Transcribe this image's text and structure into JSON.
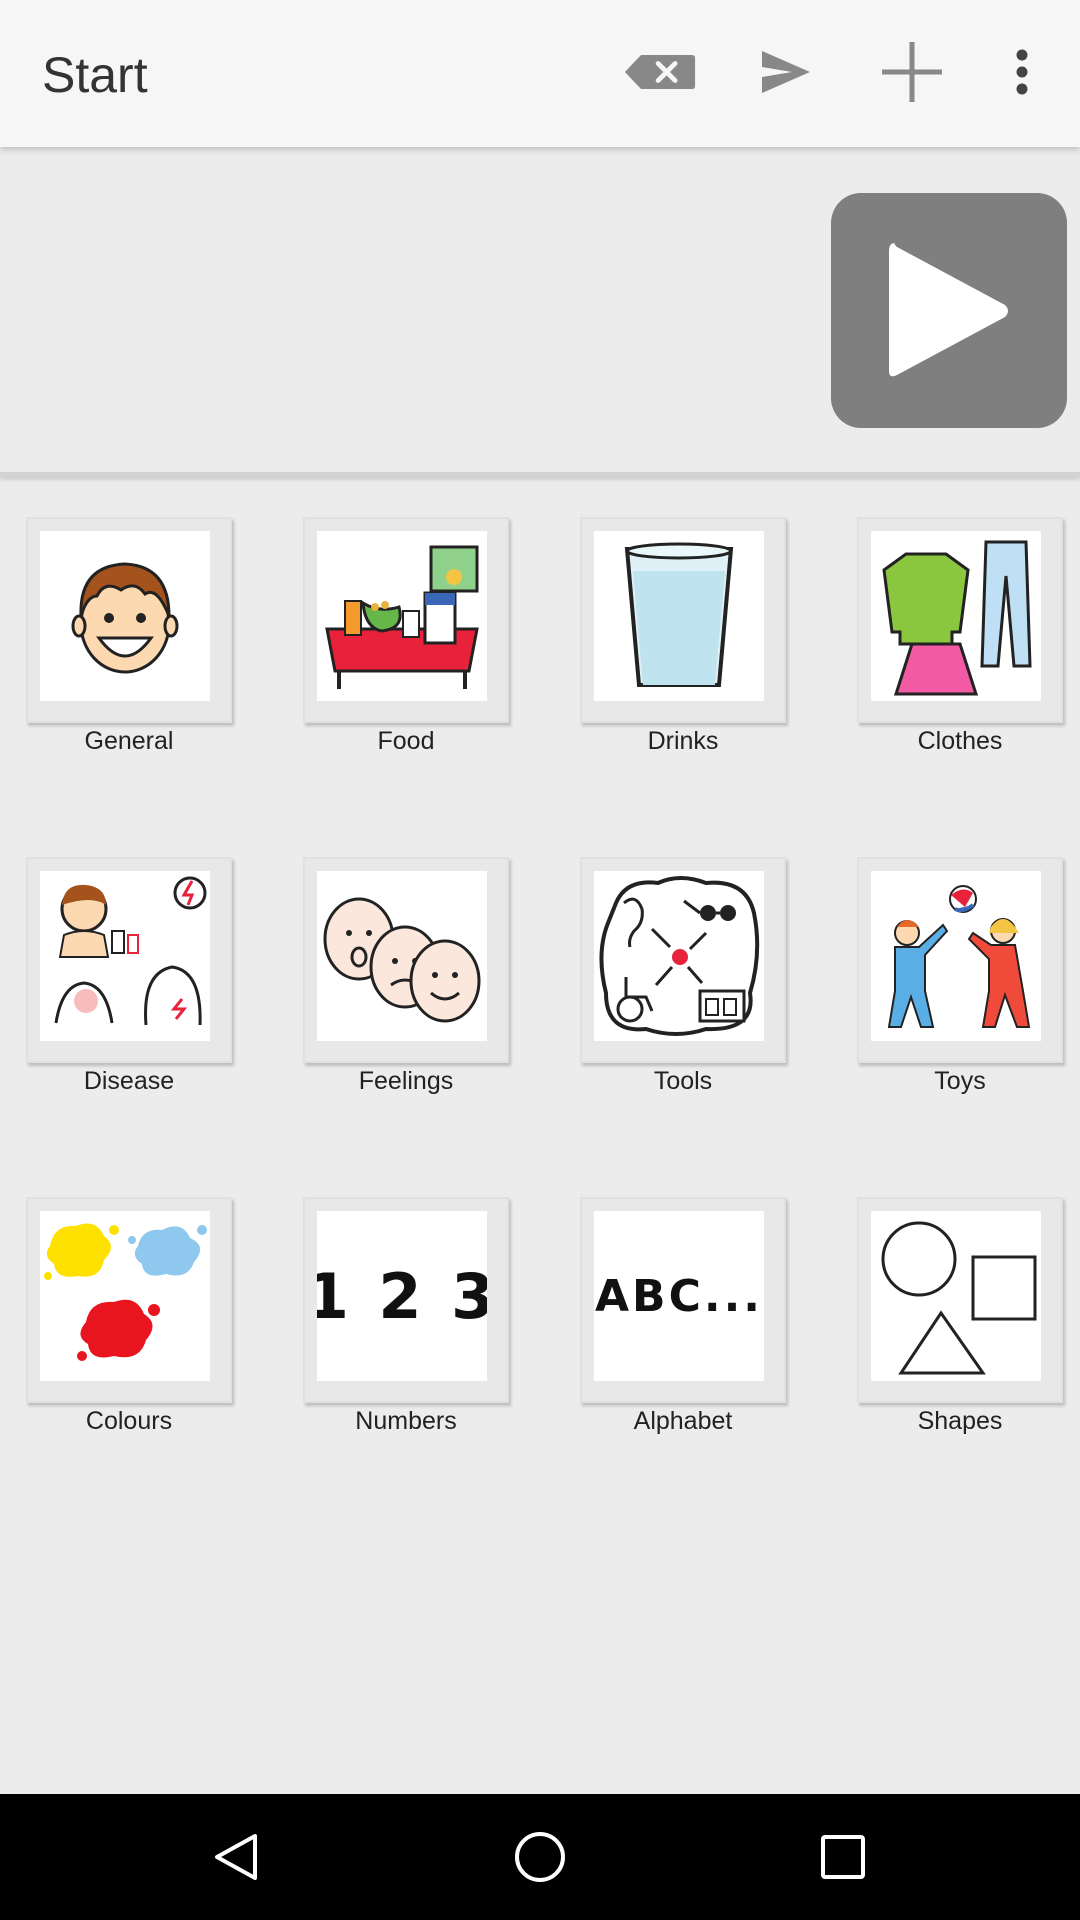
{
  "app_bar": {
    "title": "Start",
    "actions": [
      {
        "icon": "backspace-icon"
      },
      {
        "icon": "send-icon"
      },
      {
        "icon": "add-icon"
      },
      {
        "icon": "more-vert-icon"
      }
    ]
  },
  "sentence_bar": {
    "play_icon": "play-icon"
  },
  "categories": [
    {
      "label": "General",
      "icon": "smiling-boy-icon"
    },
    {
      "label": "Food",
      "icon": "food-table-icon"
    },
    {
      "label": "Drinks",
      "icon": "glass-of-water-icon"
    },
    {
      "label": "Clothes",
      "icon": "clothes-icon"
    },
    {
      "label": "Disease",
      "icon": "sick-person-icon"
    },
    {
      "label": "Feelings",
      "icon": "faces-icon"
    },
    {
      "label": "Tools",
      "icon": "assistive-tools-icon"
    },
    {
      "label": "Toys",
      "icon": "children-playing-ball-icon"
    },
    {
      "label": "Colours",
      "icon": "paint-splashes-icon"
    },
    {
      "label": "Numbers",
      "icon": "numbers-icon",
      "glyph": "1 2 3"
    },
    {
      "label": "Alphabet",
      "icon": "alphabet-icon",
      "glyph": "ABC..."
    },
    {
      "label": "Shapes",
      "icon": "shapes-icon"
    }
  ],
  "colors": {
    "app_bar": "#f6f6f6",
    "background": "#ececec",
    "play_button": "#7f7f7f",
    "icon_gray": "#888888"
  },
  "nav": [
    {
      "icon": "back-icon"
    },
    {
      "icon": "home-icon"
    },
    {
      "icon": "recents-icon"
    }
  ]
}
